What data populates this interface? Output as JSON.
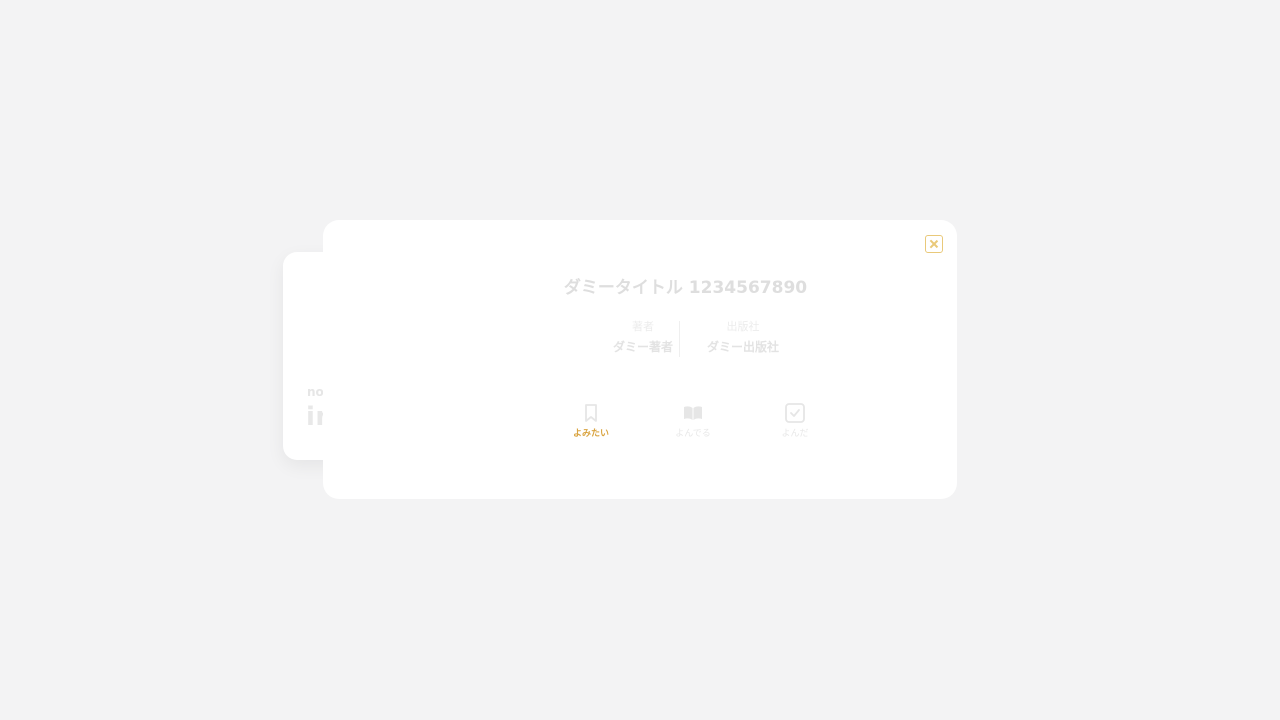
{
  "cover": {
    "small_label": "no",
    "big_label": "image"
  },
  "book": {
    "title": "ダミータイトル 1234567890",
    "author_label": "著者",
    "author_value": "ダミー著者",
    "publisher_label": "出版社",
    "publisher_value": "ダミー出版社"
  },
  "actions": [
    {
      "label": "よみたい",
      "icon": "bookmark-icon",
      "active": true
    },
    {
      "label": "よんでる",
      "icon": "open-book-icon",
      "active": false
    },
    {
      "label": "よんだ",
      "icon": "check-box-icon",
      "active": false
    }
  ],
  "colors": {
    "background": "#f3f3f4",
    "card": "#ffffff",
    "accent": "#d9a441",
    "muted_text": "#e3e3e3"
  }
}
